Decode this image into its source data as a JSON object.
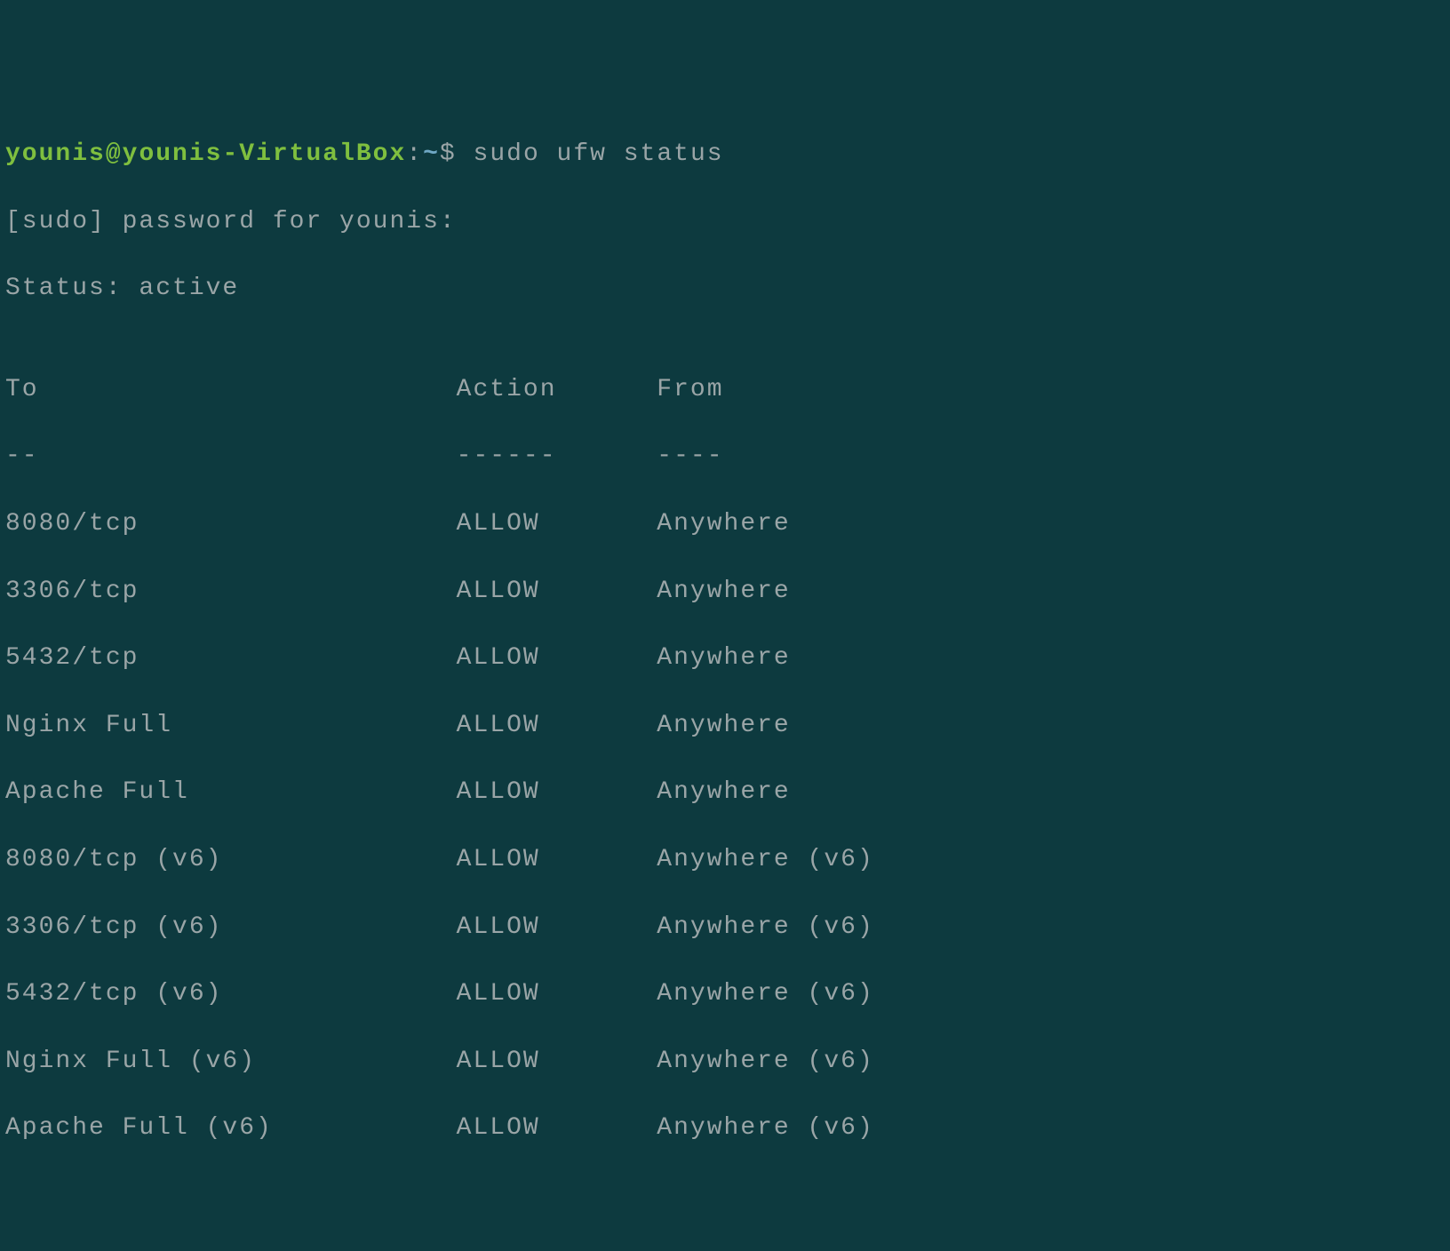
{
  "prompt": {
    "user": "younis",
    "at": "@",
    "host": "younis-VirtualBox",
    "colon": ":",
    "path": "~",
    "dollar": "$ ",
    "command": "sudo ufw status"
  },
  "sudo_line": "[sudo] password for younis:",
  "status_line": "Status: active",
  "blank": "",
  "header": {
    "to": "To                         Action      From",
    "sep": "--                         ------      ----"
  },
  "rules": [
    "8080/tcp                   ALLOW       Anywhere",
    "3306/tcp                   ALLOW       Anywhere",
    "5432/tcp                   ALLOW       Anywhere",
    "Nginx Full                 ALLOW       Anywhere",
    "Apache Full                ALLOW       Anywhere",
    "8080/tcp (v6)              ALLOW       Anywhere (v6)",
    "3306/tcp (v6)              ALLOW       Anywhere (v6)",
    "5432/tcp (v6)              ALLOW       Anywhere (v6)",
    "Nginx Full (v6)            ALLOW       Anywhere (v6)",
    "Apache Full (v6)           ALLOW       Anywhere (v6)"
  ]
}
